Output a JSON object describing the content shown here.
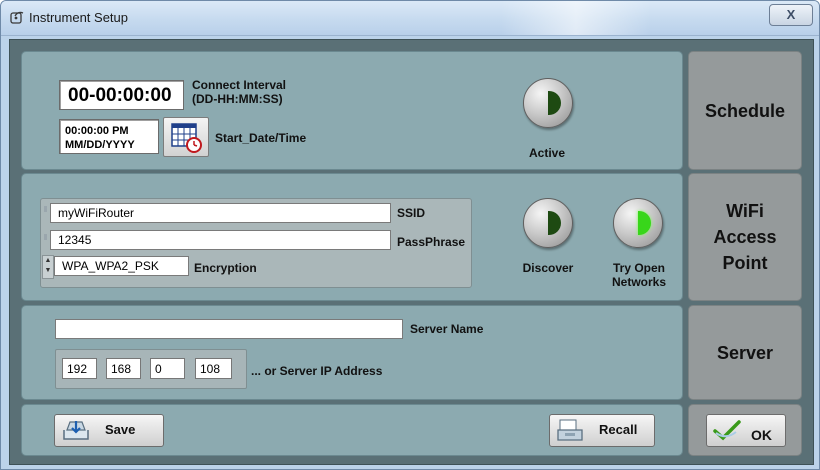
{
  "window": {
    "title": "Instrument Setup",
    "close_label": "X"
  },
  "schedule": {
    "connect_interval_value": "00-00:00:00",
    "connect_interval_label_line1": "Connect Interval",
    "connect_interval_label_line2": "(DD-HH:MM:SS)",
    "start_time_value": "00:00:00 PM",
    "start_date_value": "MM/DD/YYYY",
    "start_datetime_label": "Start_Date/Time",
    "active_label": "Active",
    "section_label": "Schedule"
  },
  "wifi": {
    "ssid_value": "myWiFiRouter",
    "ssid_label": "SSID",
    "passphrase_value": "12345",
    "passphrase_label": "PassPhrase",
    "encryption_value": "WPA_WPA2_PSK",
    "encryption_label": "Encryption",
    "discover_label": "Discover",
    "try_open_label_line1": "Try Open",
    "try_open_label_line2": "Networks",
    "try_open_active": true,
    "section_label_line1": "WiFi",
    "section_label_line2": "Access",
    "section_label_line3": "Point"
  },
  "server": {
    "server_name_value": "",
    "server_name_label": "Server Name",
    "ip_octets": [
      "192",
      "168",
      "0",
      "108"
    ],
    "ip_label": "... or Server IP Address",
    "section_label": "Server"
  },
  "actions": {
    "save_label": "Save",
    "recall_label": "Recall",
    "ok_label": "OK"
  },
  "colors": {
    "led_on": "#38d61a",
    "led_off": "#1e4a12",
    "panel": "#8caab0",
    "side_panel": "#959a9b"
  }
}
